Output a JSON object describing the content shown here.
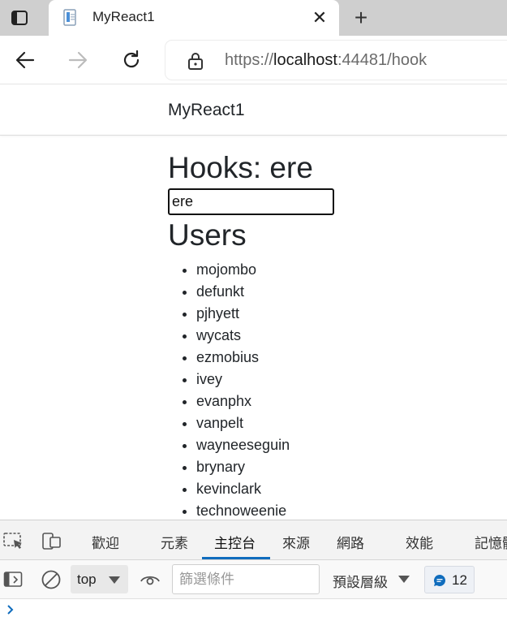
{
  "browser": {
    "tab_title": "MyReact1",
    "tab_close": "✕",
    "new_tab": "+",
    "url_scheme": "https://",
    "url_host": "localhost",
    "url_rest": ":44481/hook"
  },
  "app": {
    "brand": "MyReact1",
    "hooks_heading": "Hooks: ere",
    "search_value": "ere",
    "users_heading": "Users",
    "users": [
      "mojombo",
      "defunkt",
      "pjhyett",
      "wycats",
      "ezmobius",
      "ivey",
      "evanphx",
      "vanpelt",
      "wayneeseguin",
      "brynary",
      "kevinclark",
      "technoweenie"
    ]
  },
  "devtools": {
    "tabs": [
      "歡迎",
      "元素",
      "主控台",
      "來源",
      "網路",
      "效能",
      "記憶體"
    ],
    "active_tab": "主控台",
    "context": "top",
    "filter_placeholder": "篩選條件",
    "levels": "預設層級",
    "issues_count": "12",
    "accent": "#0f6cbd"
  }
}
